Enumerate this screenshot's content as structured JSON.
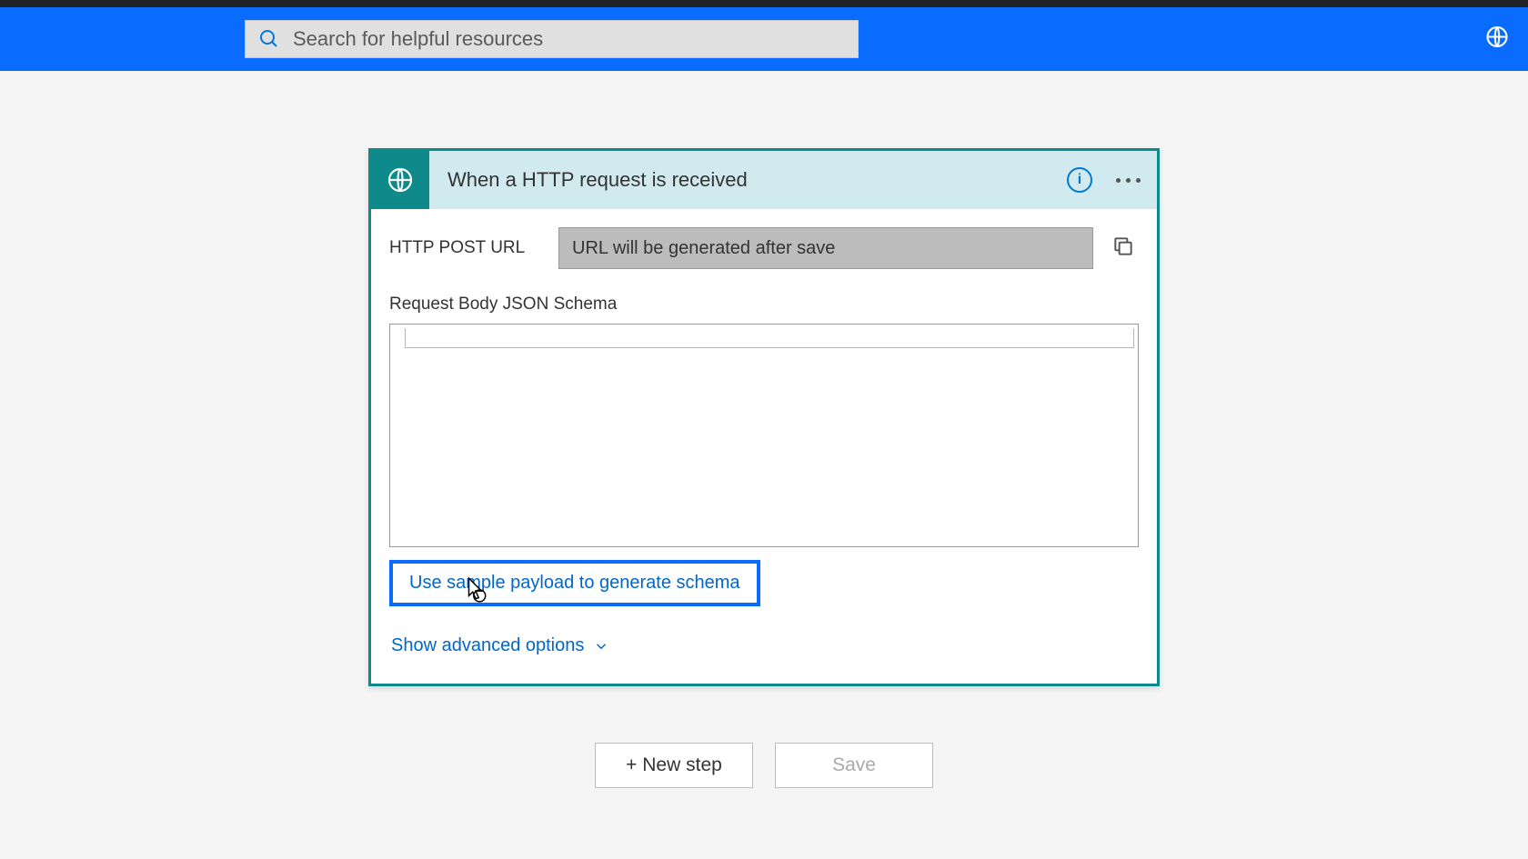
{
  "search": {
    "placeholder": "Search for helpful resources"
  },
  "card": {
    "title": "When a HTTP request is received",
    "url_label": "HTTP POST URL",
    "url_value": "URL will be generated after save",
    "schema_label": "Request Body JSON Schema",
    "sample_link": "Use sample payload to generate schema",
    "advanced_link": "Show advanced options"
  },
  "buttons": {
    "new_step": "+ New step",
    "save": "Save"
  }
}
